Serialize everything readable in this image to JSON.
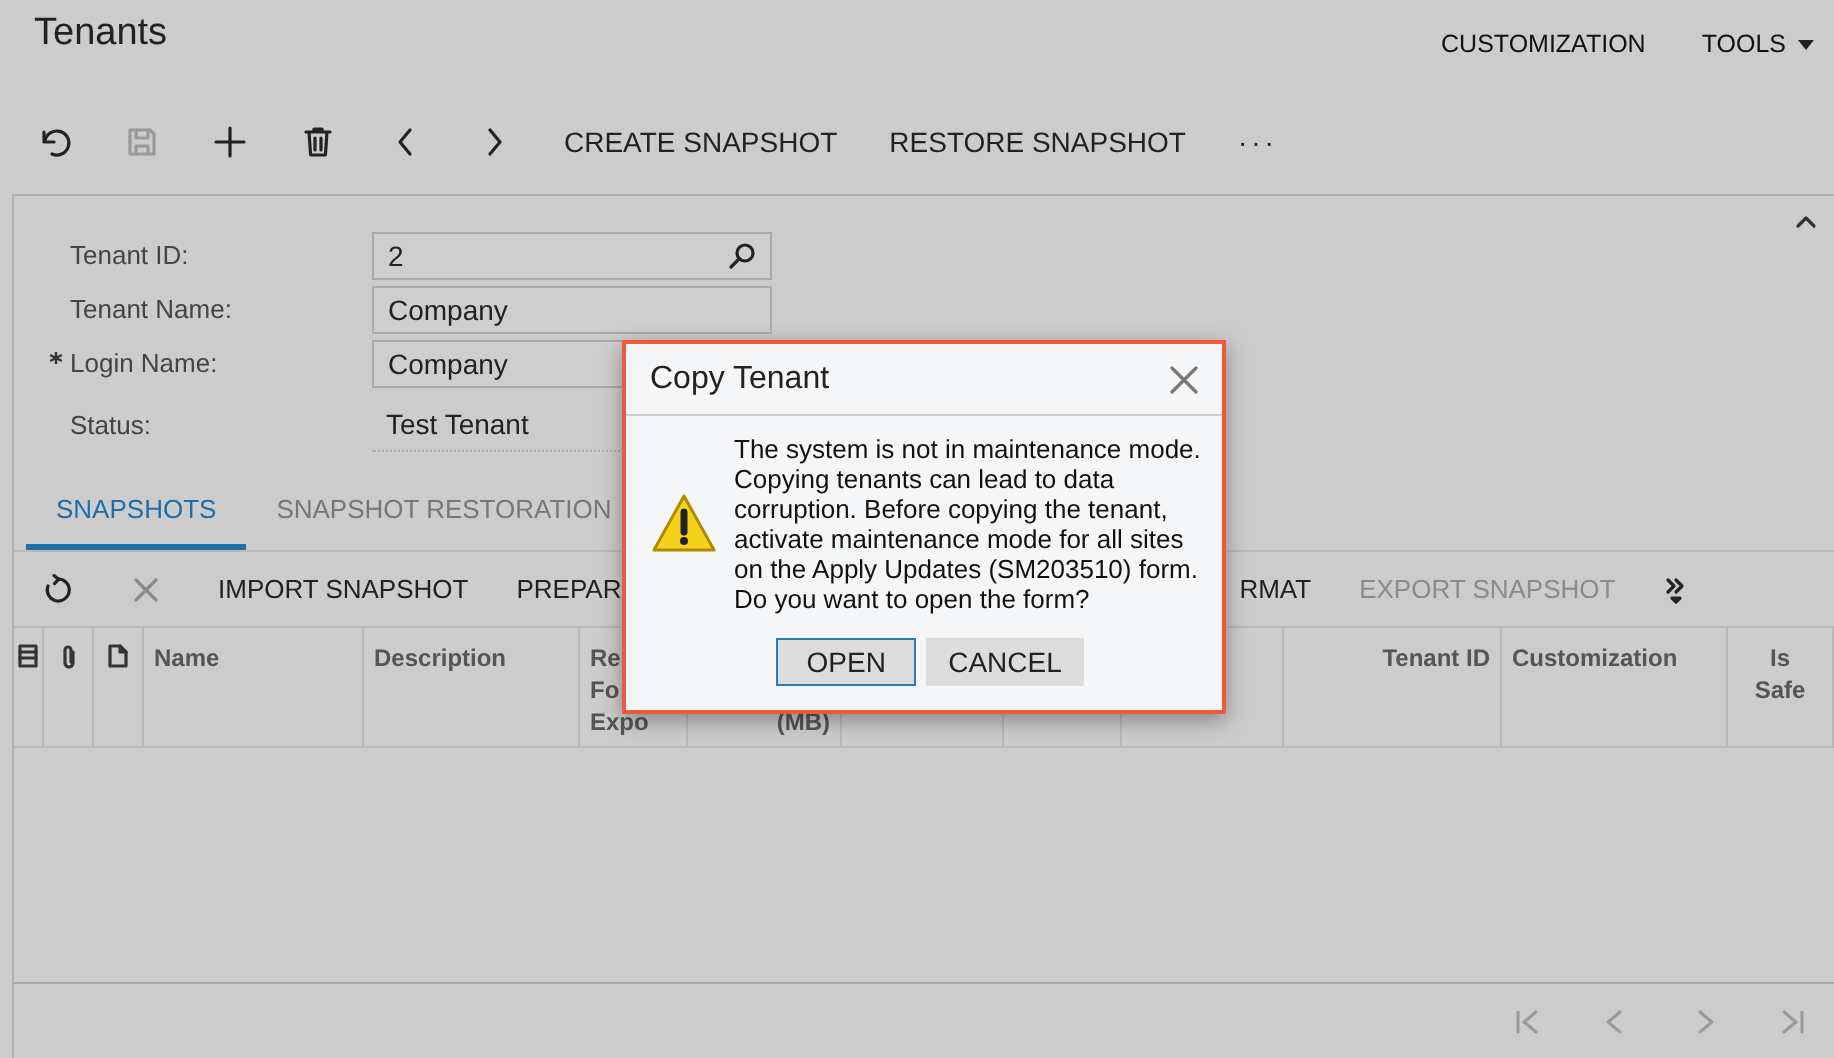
{
  "title": "Tenants",
  "header_menu": [
    {
      "label": "CUSTOMIZATION",
      "dropdown": false
    },
    {
      "label": "TOOLS",
      "dropdown": true
    }
  ],
  "toolbar": [
    {
      "kind": "icon",
      "disabled": false
    },
    {
      "kind": "icon",
      "disabled": true
    },
    {
      "kind": "icon",
      "disabled": false
    },
    {
      "kind": "icon",
      "disabled": false
    },
    {
      "kind": "icon",
      "disabled": false
    },
    {
      "kind": "icon",
      "disabled": false
    },
    {
      "kind": "text",
      "label": "CREATE SNAPSHOT",
      "disabled": false
    },
    {
      "kind": "text",
      "label": "RESTORE SNAPSHOT",
      "disabled": false
    },
    {
      "kind": "text",
      "label": "···",
      "disabled": false
    }
  ],
  "form": {
    "expanded": true,
    "fields": [
      {
        "label": "Tenant ID:",
        "required": false,
        "kind": "lookup",
        "value": "2"
      },
      {
        "label": "Tenant Name:",
        "required": false,
        "kind": "text",
        "value": "Company"
      },
      {
        "label": "Login Name:",
        "required": true,
        "kind": "text",
        "value": "Company"
      },
      {
        "label": "Status:",
        "required": false,
        "kind": "readonly",
        "value": "Test Tenant"
      }
    ]
  },
  "tabs": [
    {
      "label": "SNAPSHOTS",
      "selected": true
    },
    {
      "label": "SNAPSHOT RESTORATION",
      "selected": false
    }
  ],
  "grid_toolbar": [
    {
      "kind": "icon",
      "disabled": false
    },
    {
      "kind": "icon",
      "disabled": true
    },
    {
      "kind": "text",
      "label": "IMPORT SNAPSHOT",
      "disabled": false
    },
    {
      "kind": "text",
      "label": "PREPAR",
      "disabled": false
    },
    {
      "kind": "text_after_dialog",
      "label": "RMAT",
      "disabled": false
    },
    {
      "kind": "text",
      "label": "EXPORT SNAPSHOT",
      "disabled": true
    },
    {
      "kind": "more",
      "disabled": false
    }
  ],
  "columns": [
    {
      "kind": "icon"
    },
    {
      "kind": "icon"
    },
    {
      "kind": "icon"
    },
    {
      "kind": "text",
      "label": "Name"
    },
    {
      "kind": "text",
      "label": "Description"
    },
    {
      "kind": "text",
      "label": "Re\nFo\nExpo"
    },
    {
      "kind": "number",
      "label": "\n\n(MB)"
    },
    {
      "kind": "blank"
    },
    {
      "kind": "blank"
    },
    {
      "kind": "blank"
    },
    {
      "kind": "number",
      "label": "Tenant ID"
    },
    {
      "kind": "text",
      "label": "Customization"
    },
    {
      "kind": "flag",
      "label": "Is\nSafe"
    }
  ],
  "dialog": {
    "title": "Copy Tenant",
    "message": "The system is not in maintenance mode. Copying tenants can lead to data corruption. Before copying the tenant, activate maintenance mode for all sites on the Apply Updates (SM203510) form. Do you want to open the form?",
    "buttons": [
      {
        "label": "OPEN",
        "selected": true
      },
      {
        "label": "CANCEL",
        "selected": false
      }
    ]
  }
}
